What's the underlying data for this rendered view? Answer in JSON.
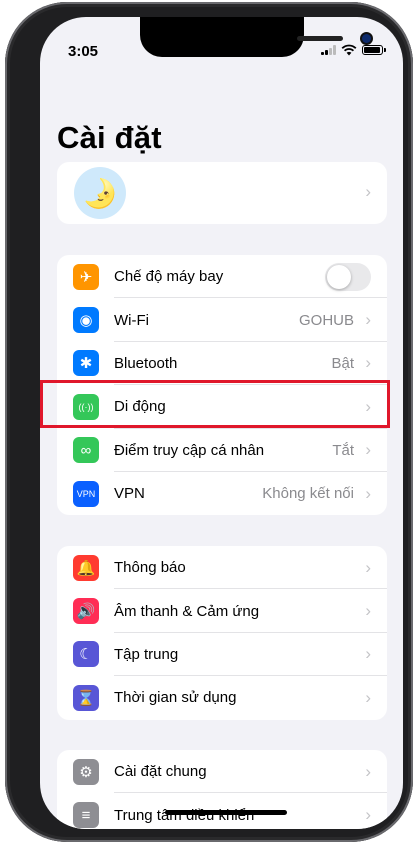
{
  "status_bar": {
    "time": "3:05"
  },
  "page": {
    "title": "Cài đặt"
  },
  "profile": {
    "avatar_icon": "moon-face-icon",
    "avatar_glyph": "🌛"
  },
  "group1": [
    {
      "id": "airplane",
      "label": "Chế độ máy bay",
      "icon": "airplane-icon",
      "glyph": "✈",
      "color": "#ff9500",
      "toggle": false
    },
    {
      "id": "wifi",
      "label": "Wi‑Fi",
      "value": "GOHUB",
      "icon": "wifi-icon",
      "glyph": "◉",
      "color": "#007aff"
    },
    {
      "id": "bluetooth",
      "label": "Bluetooth",
      "value": "Bật",
      "icon": "bluetooth-icon",
      "glyph": "✱",
      "color": "#007aff"
    },
    {
      "id": "mobile",
      "label": "Di động",
      "icon": "antenna-icon",
      "glyph": "((·))",
      "color": "#34c759"
    },
    {
      "id": "hotspot",
      "label": "Điểm truy cập cá nhân",
      "value": "Tắt",
      "icon": "hotspot-icon",
      "glyph": "∞",
      "color": "#34c759"
    },
    {
      "id": "vpn",
      "label": "VPN",
      "value": "Không kết nối",
      "icon": "vpn-icon",
      "glyph": "VPN",
      "color": "#0a60ff"
    }
  ],
  "group2": [
    {
      "id": "notifications",
      "label": "Thông báo",
      "icon": "bell-icon",
      "glyph": "🔔",
      "color": "#ff3b30"
    },
    {
      "id": "sounds",
      "label": "Âm thanh & Cảm ứng",
      "icon": "speaker-icon",
      "glyph": "🔊",
      "color": "#ff2d55"
    },
    {
      "id": "focus",
      "label": "Tập trung",
      "icon": "moon-icon",
      "glyph": "☾",
      "color": "#5856d6"
    },
    {
      "id": "screentime",
      "label": "Thời gian sử dụng",
      "icon": "hourglass-icon",
      "glyph": "⌛",
      "color": "#5856d6"
    }
  ],
  "group3": [
    {
      "id": "general",
      "label": "Cài đặt chung",
      "icon": "gear-icon",
      "glyph": "⚙",
      "color": "#8e8e93"
    },
    {
      "id": "control",
      "label": "Trung tâm điều khiển",
      "icon": "switches-icon",
      "glyph": "≡",
      "color": "#8e8e93"
    }
  ],
  "chevron": "›",
  "colors": {
    "highlight": "#e0172b",
    "background": "#f2f2f7"
  }
}
